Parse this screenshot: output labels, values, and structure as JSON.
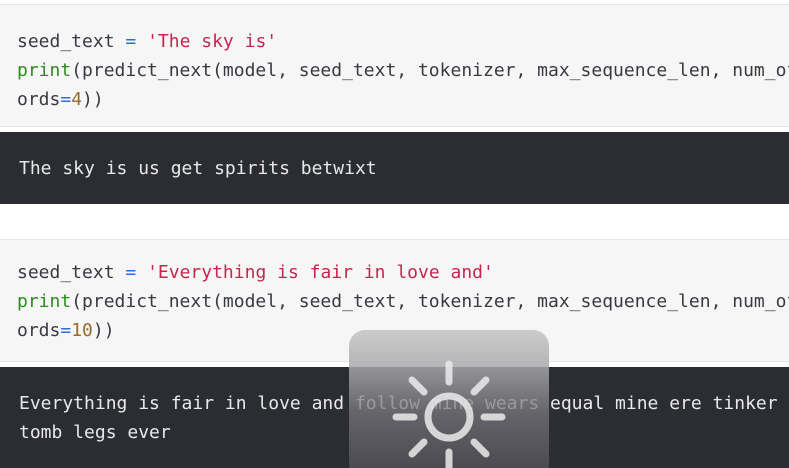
{
  "cell1": {
    "line1": {
      "var": "seed_text",
      "eq": "=",
      "str": "'The sky is'"
    },
    "line2": {
      "fn": "print",
      "rest": "(predict_next(model, seed_text, tokenizer, max_sequence_len, num_of_w"
    },
    "line3": {
      "pre": "ords",
      "eq": "=",
      "num": "4",
      "post": "))"
    }
  },
  "output1": {
    "text": "The sky is us get spirits betwixt"
  },
  "cell2": {
    "line1": {
      "var": "seed_text",
      "eq": "=",
      "str": "'Everything is fair in love and'"
    },
    "line2": {
      "fn": "print",
      "rest": "(predict_next(model, seed_text, tokenizer, max_sequence_len, num_of_w"
    },
    "line3": {
      "pre": "ords",
      "eq": "=",
      "num": "10",
      "post": "))"
    }
  },
  "output2": {
    "line1": "Everything is fair in love and follow mine wears equal mine ere tinker",
    "line2": "tomb legs ever"
  },
  "overlay": {
    "icon": "brightness-sun-icon"
  }
}
